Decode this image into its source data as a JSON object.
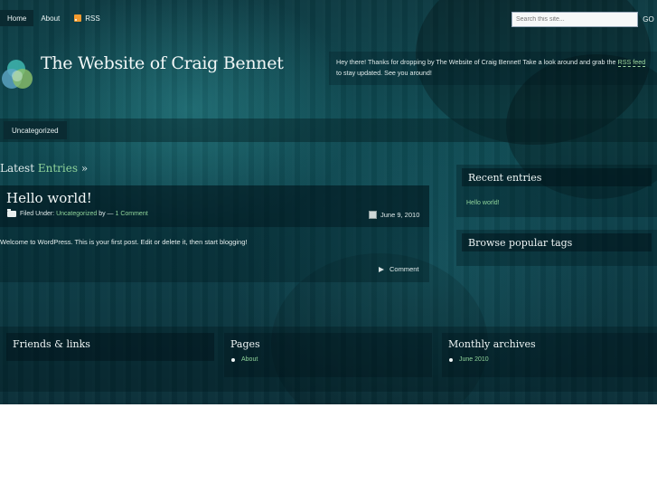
{
  "nav": {
    "home": "Home",
    "about": "About",
    "rss": "RSS"
  },
  "search": {
    "placeholder": "Search this site...",
    "go": "GO"
  },
  "header": {
    "title": "The Website of Craig Bennet",
    "welcome_before": "Hey there! Thanks for dropping by The Website of Craig Bennet! Take a look around and grab the ",
    "welcome_link": "RSS feed",
    "welcome_after": " to stay updated. See you around!"
  },
  "categories": {
    "items": [
      "Uncategorized"
    ]
  },
  "latest": {
    "label": "Latest",
    "accent": "Entries",
    "arrow": "»"
  },
  "post": {
    "title": "Hello world!",
    "filed_under": "Filed Under:",
    "category": "Uncategorized",
    "by": "by —",
    "comments": "1 Comment",
    "date": "June 9, 2010",
    "body": "Welcome to WordPress. This is your first post. Edit or delete it, then start blogging!",
    "comment_label": "Comment"
  },
  "sidebar": {
    "recent_title": "Recent entries",
    "recent_items": [
      "Hello world!"
    ],
    "tags_title": "Browse popular tags"
  },
  "footer": {
    "friends_title": "Friends & links",
    "pages_title": "Pages",
    "pages_items": [
      "About"
    ],
    "archives_title": "Monthly archives",
    "archives_items": [
      "June 2010"
    ]
  },
  "colors": {
    "accent_link": "#8fd39a",
    "background_teal": "#0e4a52",
    "rss_orange": "#f29b2f"
  }
}
